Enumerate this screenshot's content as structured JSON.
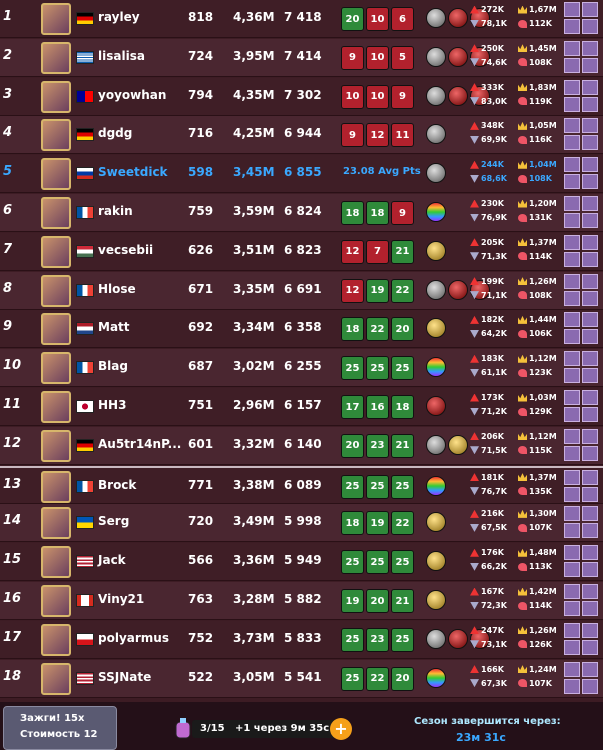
{
  "rows": [
    {
      "rank": "1",
      "name": "rayley",
      "flag": "de",
      "level": "818",
      "power": "4,36M",
      "points": "7 418",
      "record": [
        {
          "v": "20",
          "c": "g"
        },
        {
          "v": "10",
          "c": "r"
        },
        {
          "v": "6",
          "c": "r"
        }
      ],
      "avg": "",
      "gems": [
        "gray",
        "red",
        "red"
      ],
      "stat1": "272K",
      "stat2": "78,1K",
      "stat3": "1,67M",
      "stat4": "112K"
    },
    {
      "rank": "2",
      "name": "lisalisa",
      "flag": "gr",
      "level": "724",
      "power": "3,95M",
      "points": "7 414",
      "record": [
        {
          "v": "9",
          "c": "r"
        },
        {
          "v": "10",
          "c": "r"
        },
        {
          "v": "5",
          "c": "r"
        }
      ],
      "avg": "",
      "gems": [
        "gray",
        "red",
        "red"
      ],
      "stat1": "250K",
      "stat2": "74,6K",
      "stat3": "1,45M",
      "stat4": "108K"
    },
    {
      "rank": "3",
      "name": "yoyowhan",
      "flag": "tw",
      "level": "794",
      "power": "4,35M",
      "points": "7 302",
      "record": [
        {
          "v": "10",
          "c": "r"
        },
        {
          "v": "10",
          "c": "r"
        },
        {
          "v": "9",
          "c": "r"
        }
      ],
      "avg": "",
      "gems": [
        "gray",
        "red",
        "red"
      ],
      "stat1": "333K",
      "stat2": "83,0K",
      "stat3": "1,83M",
      "stat4": "119K"
    },
    {
      "rank": "4",
      "name": "dgdg",
      "flag": "de",
      "level": "716",
      "power": "4,25M",
      "points": "6 944",
      "record": [
        {
          "v": "9",
          "c": "r"
        },
        {
          "v": "12",
          "c": "r"
        },
        {
          "v": "11",
          "c": "r"
        }
      ],
      "avg": "",
      "gems": [
        "gray"
      ],
      "stat1": "348K",
      "stat2": "69,9K",
      "stat3": "1,05M",
      "stat4": "116K"
    },
    {
      "rank": "5",
      "name": "Sweetdick",
      "flag": "ru",
      "level": "598",
      "power": "3,45M",
      "points": "6 855",
      "record": [],
      "avg": "23.08 Avg Pts",
      "gems": [
        "gray"
      ],
      "stat1": "244K",
      "stat2": "68,6K",
      "stat3": "1,04M",
      "stat4": "108K"
    },
    {
      "rank": "6",
      "name": "rakin",
      "flag": "fr",
      "level": "759",
      "power": "3,59M",
      "points": "6 824",
      "record": [
        {
          "v": "18",
          "c": "g"
        },
        {
          "v": "18",
          "c": "g"
        },
        {
          "v": "9",
          "c": "r"
        }
      ],
      "avg": "",
      "gems": [
        "rainbow"
      ],
      "stat1": "230K",
      "stat2": "76,9K",
      "stat3": "1,20M",
      "stat4": "131K"
    },
    {
      "rank": "7",
      "name": "vecsebii",
      "flag": "hu",
      "level": "626",
      "power": "3,51M",
      "points": "6 823",
      "record": [
        {
          "v": "12",
          "c": "r"
        },
        {
          "v": "7",
          "c": "r"
        },
        {
          "v": "21",
          "c": "g"
        }
      ],
      "avg": "",
      "gems": [
        "gold"
      ],
      "stat1": "205K",
      "stat2": "71,3K",
      "stat3": "1,37M",
      "stat4": "114K"
    },
    {
      "rank": "8",
      "name": "Hlose",
      "flag": "fr",
      "level": "671",
      "power": "3,35M",
      "points": "6 691",
      "record": [
        {
          "v": "12",
          "c": "r"
        },
        {
          "v": "19",
          "c": "g"
        },
        {
          "v": "22",
          "c": "g"
        }
      ],
      "avg": "",
      "gems": [
        "gray",
        "red",
        "red"
      ],
      "stat1": "199K",
      "stat2": "71,1K",
      "stat3": "1,26M",
      "stat4": "108K"
    },
    {
      "rank": "9",
      "name": "Matt",
      "flag": "nl",
      "level": "692",
      "power": "3,34M",
      "points": "6 358",
      "record": [
        {
          "v": "18",
          "c": "g"
        },
        {
          "v": "22",
          "c": "g"
        },
        {
          "v": "20",
          "c": "g"
        }
      ],
      "avg": "",
      "gems": [
        "gold"
      ],
      "stat1": "182K",
      "stat2": "64,2K",
      "stat3": "1,44M",
      "stat4": "106K"
    },
    {
      "rank": "10",
      "name": "Blag",
      "flag": "fr",
      "level": "687",
      "power": "3,02M",
      "points": "6 255",
      "record": [
        {
          "v": "25",
          "c": "g"
        },
        {
          "v": "25",
          "c": "g"
        },
        {
          "v": "25",
          "c": "g"
        }
      ],
      "avg": "",
      "gems": [
        "rainbow"
      ],
      "stat1": "183K",
      "stat2": "61,1K",
      "stat3": "1,12M",
      "stat4": "123K"
    },
    {
      "rank": "11",
      "name": "HH3",
      "flag": "jp",
      "level": "751",
      "power": "2,96M",
      "points": "6 157",
      "record": [
        {
          "v": "17",
          "c": "g"
        },
        {
          "v": "16",
          "c": "g"
        },
        {
          "v": "18",
          "c": "g"
        }
      ],
      "avg": "",
      "gems": [
        "red"
      ],
      "stat1": "173K",
      "stat2": "71,2K",
      "stat3": "1,03M",
      "stat4": "129K"
    },
    {
      "rank": "12",
      "name": "Au5tr14nP...",
      "flag": "de",
      "level": "601",
      "power": "3,32M",
      "points": "6 140",
      "record": [
        {
          "v": "20",
          "c": "g"
        },
        {
          "v": "23",
          "c": "g"
        },
        {
          "v": "21",
          "c": "g"
        }
      ],
      "avg": "",
      "gems": [
        "gray",
        "gold"
      ],
      "stat1": "206K",
      "stat2": "71,5K",
      "stat3": "1,12M",
      "stat4": "115K"
    },
    {
      "rank": "13",
      "name": "Brock",
      "flag": "fr",
      "level": "771",
      "power": "3,38M",
      "points": "6 089",
      "record": [
        {
          "v": "25",
          "c": "g"
        },
        {
          "v": "25",
          "c": "g"
        },
        {
          "v": "25",
          "c": "g"
        }
      ],
      "avg": "",
      "gems": [
        "rainbow"
      ],
      "stat1": "181K",
      "stat2": "76,7K",
      "stat3": "1,37M",
      "stat4": "135K"
    },
    {
      "rank": "14",
      "name": "Serg",
      "flag": "ua",
      "level": "720",
      "power": "3,49M",
      "points": "5 998",
      "record": [
        {
          "v": "18",
          "c": "g"
        },
        {
          "v": "19",
          "c": "g"
        },
        {
          "v": "22",
          "c": "g"
        }
      ],
      "avg": "",
      "gems": [
        "gold"
      ],
      "stat1": "216K",
      "stat2": "67,5K",
      "stat3": "1,30M",
      "stat4": "107K"
    },
    {
      "rank": "15",
      "name": "Jack",
      "flag": "us",
      "level": "566",
      "power": "3,36M",
      "points": "5 949",
      "record": [
        {
          "v": "25",
          "c": "g"
        },
        {
          "v": "25",
          "c": "g"
        },
        {
          "v": "25",
          "c": "g"
        }
      ],
      "avg": "",
      "gems": [
        "gold"
      ],
      "stat1": "176K",
      "stat2": "66,2K",
      "stat3": "1,48M",
      "stat4": "113K"
    },
    {
      "rank": "16",
      "name": "Viny21",
      "flag": "ca",
      "level": "763",
      "power": "3,28M",
      "points": "5 882",
      "record": [
        {
          "v": "19",
          "c": "g"
        },
        {
          "v": "20",
          "c": "g"
        },
        {
          "v": "21",
          "c": "g"
        }
      ],
      "avg": "",
      "gems": [
        "gold"
      ],
      "stat1": "167K",
      "stat2": "72,3K",
      "stat3": "1,42M",
      "stat4": "114K"
    },
    {
      "rank": "17",
      "name": "polyarmus",
      "flag": "cz",
      "level": "752",
      "power": "3,73M",
      "points": "5 833",
      "record": [
        {
          "v": "25",
          "c": "g"
        },
        {
          "v": "23",
          "c": "g"
        },
        {
          "v": "25",
          "c": "g"
        }
      ],
      "avg": "",
      "gems": [
        "gray",
        "red",
        "red"
      ],
      "stat1": "247K",
      "stat2": "73,1K",
      "stat3": "1,26M",
      "stat4": "126K"
    },
    {
      "rank": "18",
      "name": "SSJNate",
      "flag": "us",
      "level": "522",
      "power": "3,05M",
      "points": "5 541",
      "record": [
        {
          "v": "25",
          "c": "g"
        },
        {
          "v": "22",
          "c": "g"
        },
        {
          "v": "20",
          "c": "g"
        }
      ],
      "avg": "",
      "gems": [
        "rainbow"
      ],
      "stat1": "166K",
      "stat2": "67,3K",
      "stat3": "1,24M",
      "stat4": "107K"
    }
  ],
  "footer": {
    "fights_label": "Зажги! 15x",
    "cost_label": "Стоимость 12",
    "energy_text": "3/15",
    "energy_timer": "+1 через 9м 35с",
    "plus": "+",
    "season_label": "Сезон завершится через:",
    "season_time": "23м 31с"
  },
  "colors": {
    "win": "#2f8a3a",
    "loss": "#b2212d",
    "self": "#3aa8ff"
  },
  "icons": [
    "avatar-icon",
    "flag-icon",
    "gem-icon",
    "attack-icon",
    "defense-icon",
    "crown-icon",
    "heart-icon",
    "slot-icon",
    "potion-icon",
    "coin-icon"
  ]
}
